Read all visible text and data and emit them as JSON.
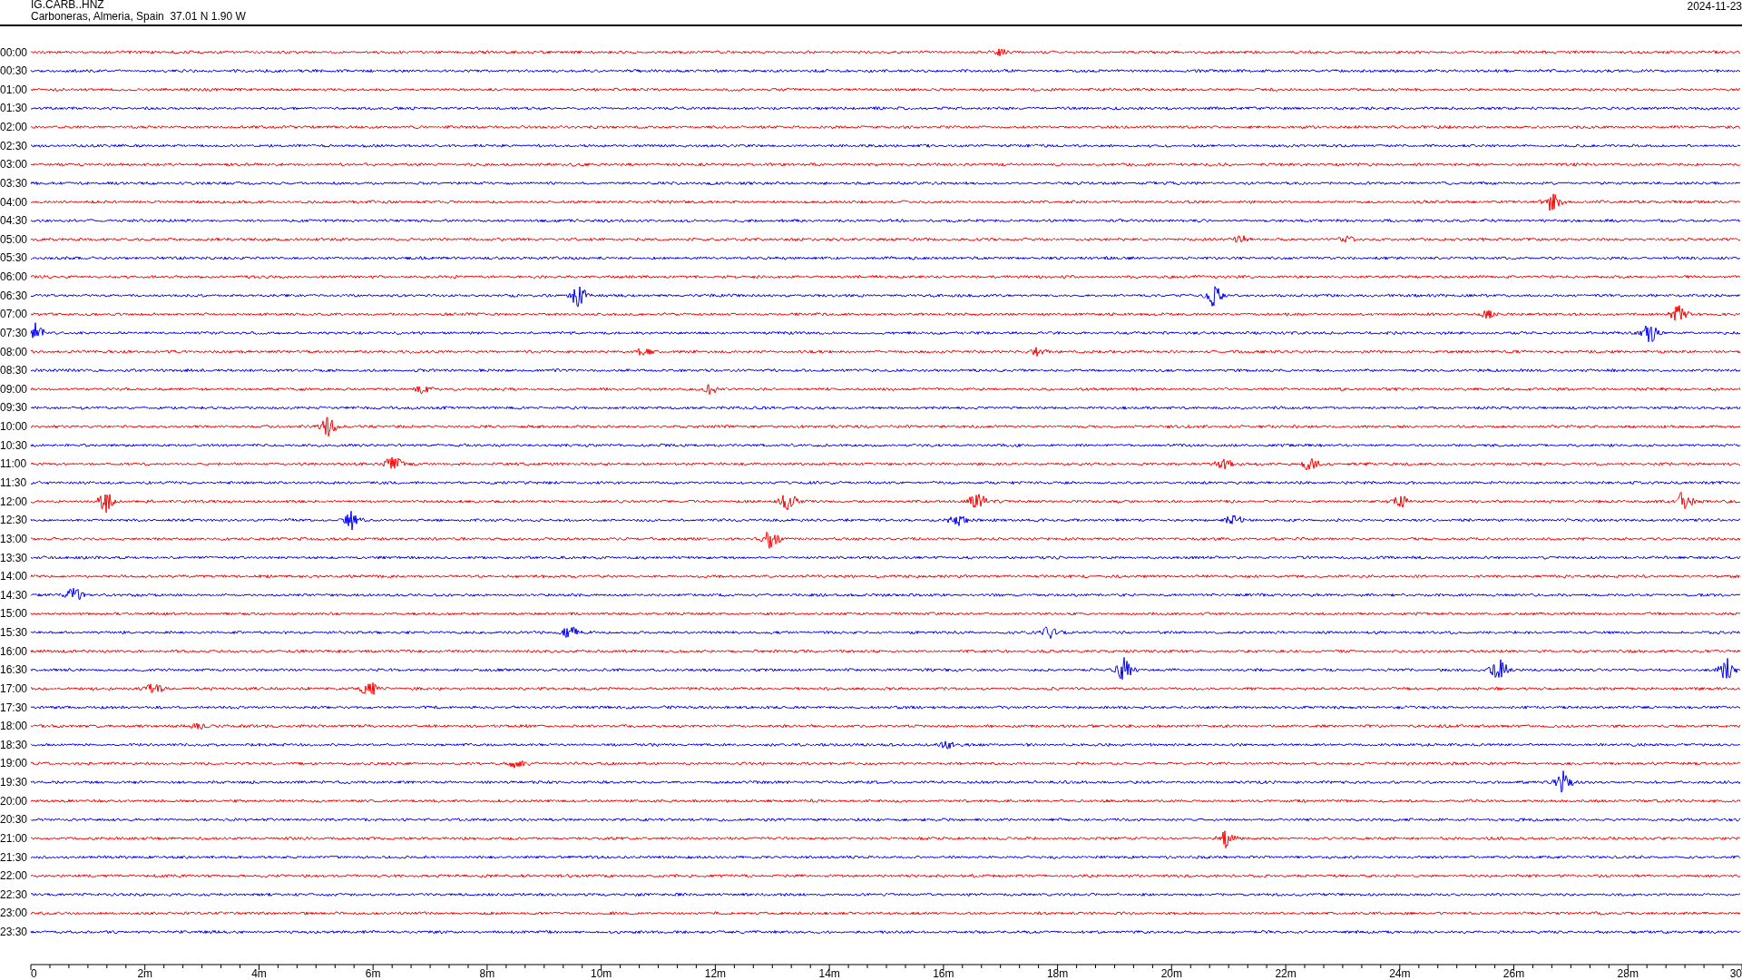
{
  "header": {
    "station": "IG.CARB..HNZ",
    "location": "Carboneras, Almeria, Spain  37.01 N 1.90 W",
    "date": "2024-11-23"
  },
  "rows": [
    {
      "label": "00:00",
      "color": "#ff0000"
    },
    {
      "label": "00:30",
      "color": "#0000ff"
    },
    {
      "label": "01:00",
      "color": "#ff0000"
    },
    {
      "label": "01:30",
      "color": "#0000ff"
    },
    {
      "label": "02:00",
      "color": "#ff0000"
    },
    {
      "label": "02:30",
      "color": "#0000ff"
    },
    {
      "label": "03:00",
      "color": "#ff0000"
    },
    {
      "label": "03:30",
      "color": "#0000ff"
    },
    {
      "label": "04:00",
      "color": "#ff0000"
    },
    {
      "label": "04:30",
      "color": "#0000ff"
    },
    {
      "label": "05:00",
      "color": "#ff0000"
    },
    {
      "label": "05:30",
      "color": "#0000ff"
    },
    {
      "label": "06:00",
      "color": "#ff0000"
    },
    {
      "label": "06:30",
      "color": "#0000ff"
    },
    {
      "label": "07:00",
      "color": "#ff0000"
    },
    {
      "label": "07:30",
      "color": "#0000ff"
    },
    {
      "label": "08:00",
      "color": "#ff0000"
    },
    {
      "label": "08:30",
      "color": "#0000ff"
    },
    {
      "label": "09:00",
      "color": "#ff0000"
    },
    {
      "label": "09:30",
      "color": "#0000ff"
    },
    {
      "label": "10:00",
      "color": "#ff0000"
    },
    {
      "label": "10:30",
      "color": "#0000ff"
    },
    {
      "label": "11:00",
      "color": "#ff0000"
    },
    {
      "label": "11:30",
      "color": "#0000ff"
    },
    {
      "label": "12:00",
      "color": "#ff0000"
    },
    {
      "label": "12:30",
      "color": "#0000ff"
    },
    {
      "label": "13:00",
      "color": "#ff0000"
    },
    {
      "label": "13:30",
      "color": "#0000ff"
    },
    {
      "label": "14:00",
      "color": "#ff0000"
    },
    {
      "label": "14:30",
      "color": "#0000ff"
    },
    {
      "label": "15:00",
      "color": "#ff0000"
    },
    {
      "label": "15:30",
      "color": "#0000ff"
    },
    {
      "label": "16:00",
      "color": "#ff0000"
    },
    {
      "label": "16:30",
      "color": "#0000ff"
    },
    {
      "label": "17:00",
      "color": "#ff0000"
    },
    {
      "label": "17:30",
      "color": "#0000ff"
    },
    {
      "label": "18:00",
      "color": "#ff0000"
    },
    {
      "label": "18:30",
      "color": "#0000ff"
    },
    {
      "label": "19:00",
      "color": "#ff0000"
    },
    {
      "label": "19:30",
      "color": "#0000ff"
    },
    {
      "label": "20:00",
      "color": "#ff0000"
    },
    {
      "label": "20:30",
      "color": "#0000ff"
    },
    {
      "label": "21:00",
      "color": "#ff0000"
    },
    {
      "label": "21:30",
      "color": "#0000ff"
    },
    {
      "label": "22:00",
      "color": "#ff0000"
    },
    {
      "label": "22:30",
      "color": "#0000ff"
    },
    {
      "label": "23:00",
      "color": "#ff0000"
    },
    {
      "label": "23:30",
      "color": "#0000ff"
    }
  ],
  "x_axis": {
    "ticks": [
      "0",
      "2m",
      "4m",
      "6m",
      "8m",
      "10m",
      "12m",
      "14m",
      "16m",
      "18m",
      "20m",
      "22m",
      "24m",
      "26m",
      "28m",
      "30"
    ]
  }
}
